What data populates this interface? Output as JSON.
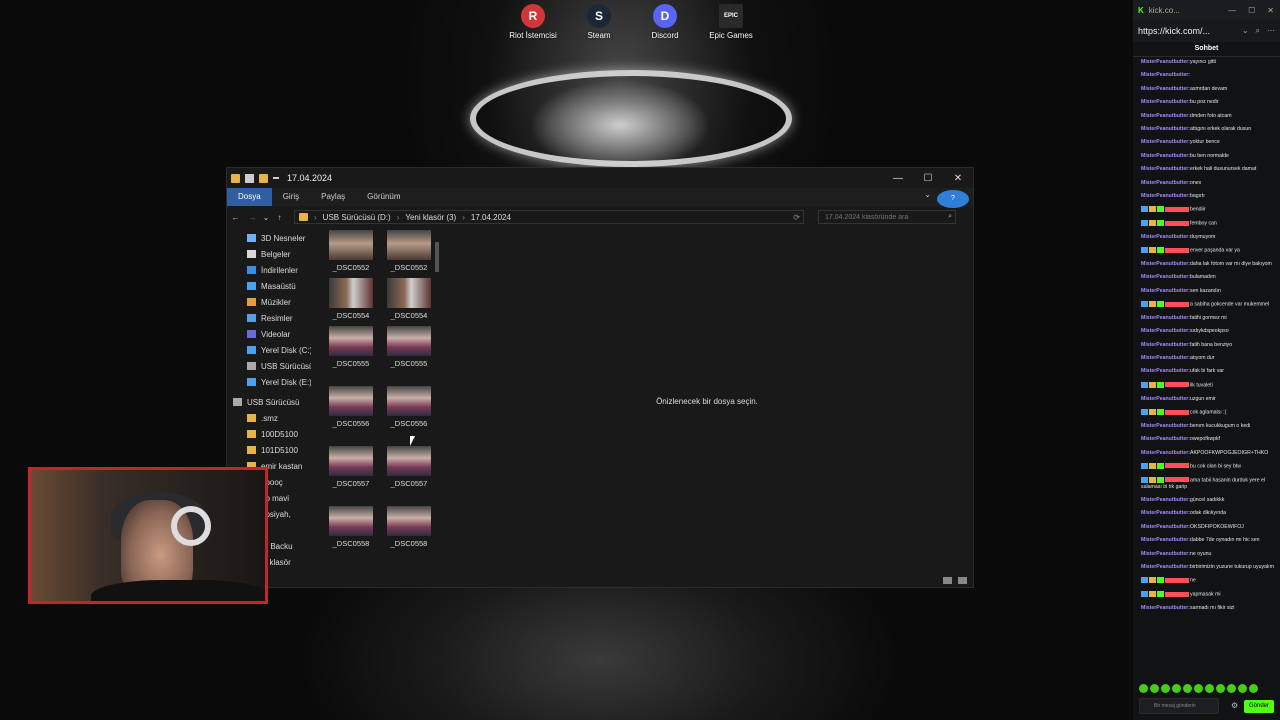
{
  "desktop": {
    "icons": [
      {
        "label": "Riot İstemcisi",
        "icon": "riot-client-icon",
        "color": "#d13639",
        "glyph": "R"
      },
      {
        "label": "Steam",
        "icon": "steam-icon",
        "color": "#1b2838",
        "glyph": "S"
      },
      {
        "label": "Discord",
        "icon": "discord-icon",
        "color": "#5865f2",
        "glyph": "D"
      },
      {
        "label": "Epic Games",
        "icon": "epic-games-icon",
        "color": "#2a2a2a",
        "glyph": "EPIC"
      }
    ]
  },
  "explorer": {
    "title": "17.04.2024",
    "ribbon_tabs": [
      "Dosya",
      "Giriş",
      "Paylaş",
      "Görünüm"
    ],
    "breadcrumb": [
      "USB Sürücüsü (D:)",
      "Yeni klasör (3)",
      "17.04.2024"
    ],
    "search_placeholder": "17.04.2024 klasöründe ara",
    "nav_items": [
      "3D Nesneler",
      "Belgeler",
      "İndirilenler",
      "Masaüstü",
      "Müzikler",
      "Resimler",
      "Videolar",
      "Yerel Disk (C:)",
      "USB Sürücüsü",
      "Yerel Disk (E:)",
      "USB Sürücüsü",
      ".smz",
      "100D5100",
      "101D5100",
      "emir kastan",
      "ooooç",
      "up mavi",
      "upsiyah,",
      "o",
      "IZ Backu",
      "ni klasör"
    ],
    "files": [
      [
        "_DSC0552",
        "_DSC0552"
      ],
      [
        "_DSC0554",
        "_DSC0554"
      ],
      [
        "_DSC0555",
        "_DSC0555"
      ],
      [
        "_DSC0556",
        "_DSC0556"
      ],
      [
        "_DSC0557",
        "_DSC0557"
      ],
      [
        "_DSC0558",
        "_DSC0558"
      ]
    ],
    "preview_text": "Önizlenecek bir dosya seçin."
  },
  "chat": {
    "tab_title": "kick.co...",
    "url": "https://kick.com/...",
    "header": "Sohbet",
    "input_placeholder": "Bir mesaj gönderin",
    "send_label": "Gönder",
    "messages": [
      {
        "user": "MisterPeanutbutter:",
        "text": "yayıncı gitti",
        "color": "#a58cff"
      },
      {
        "user": "MisterPeanutbutter:",
        "text": "",
        "color": "#a58cff"
      },
      {
        "user": "MisterPeanutbutter:",
        "text": "asmrdan devam",
        "color": "#a58cff"
      },
      {
        "user": "MisterPeanutbutter:",
        "text": "bu poz nedir",
        "color": "#a58cff"
      },
      {
        "user": "MisterPeanutbutter:",
        "text": "dmden foto atcam",
        "color": "#a58cff"
      },
      {
        "user": "MisterPeanutbutter:",
        "text": "attıgını erkek olarak dusun",
        "color": "#a58cff"
      },
      {
        "user": "MisterPeanutbutter:",
        "text": "yoktur bence",
        "color": "#a58cff"
      },
      {
        "user": "MisterPeanutbutter:",
        "text": "bu ben normalde",
        "color": "#a58cff"
      },
      {
        "user": "MisterPeanutbutter:",
        "text": "erkek hali dusunursek damat",
        "color": "#a58cff"
      },
      {
        "user": "MisterPeanutbutter:",
        "text": "onex",
        "color": "#a58cff"
      },
      {
        "user": "MisterPeanutbutter:",
        "text": "bagırtı",
        "color": "#a58cff"
      },
      {
        "user": "",
        "text": "bendiir",
        "color": "#ff4d5a",
        "badges": true
      },
      {
        "user": "",
        "text": "femboy can",
        "color": "#ff4d5a",
        "badges": true
      },
      {
        "user": "MisterPeanutbutter:",
        "text": "duymuyom",
        "color": "#a58cff"
      },
      {
        "user": "",
        "text": "enver paşanda var ya",
        "color": "#ff4d5a",
        "badges": true
      },
      {
        "user": "MisterPeanutbutter:",
        "text": "daha lak fotom var mı diye bakıyom",
        "color": "#a58cff"
      },
      {
        "user": "MisterPeanutbutter:",
        "text": "bulamadım",
        "color": "#a58cff"
      },
      {
        "user": "MisterPeanutbutter:",
        "text": "sen kazandın",
        "color": "#a58cff"
      },
      {
        "user": "",
        "text": "a sabiha gokcende var mukemmel",
        "color": "#ff4d5a",
        "badges": true
      },
      {
        "user": "MisterPeanutbutter:",
        "text": "fatihi gormez mi",
        "color": "#a58cff"
      },
      {
        "user": "MisterPeanutbutter:",
        "text": "sıdıykdspeokpso",
        "color": "#a58cff"
      },
      {
        "user": "MisterPeanutbutter:",
        "text": "fatih bana benziyo",
        "color": "#a58cff"
      },
      {
        "user": "MisterPeanutbutter:",
        "text": "atıyom dur",
        "color": "#a58cff"
      },
      {
        "user": "MisterPeanutbutter:",
        "text": "ufak bi fark var",
        "color": "#a58cff"
      },
      {
        "user": "",
        "text": "ilk tuvaleti",
        "color": "#ff4d5a",
        "badges": true
      },
      {
        "user": "MisterPeanutbutter:",
        "text": "uzgun emir",
        "color": "#a58cff"
      },
      {
        "user": "",
        "text": "cok aglamalsı :(",
        "color": "#ff4d5a",
        "badges": true
      },
      {
        "user": "MisterPeanutbutter:",
        "text": "benım kucukkugum o kedi",
        "color": "#a58cff"
      },
      {
        "user": "MisterPeanutbutter:",
        "text": "owepofkwpkf",
        "color": "#a58cff"
      },
      {
        "user": "MisterPeanutbutter:",
        "text": "AKPOOFKWPOGJEOIGR+THKO",
        "color": "#a58cff"
      },
      {
        "user": "",
        "text": "bu cok olan bi sey btw",
        "color": "#ff4d5a",
        "badges": true
      },
      {
        "user": "",
        "text": "ama tabii hasanin durduk yere el salaması bi tık garip",
        "color": "#ff4d5a",
        "badges": true
      },
      {
        "user": "MisterPeanutbutter:",
        "text": "güncel sadıkkk",
        "color": "#a58cff"
      },
      {
        "user": "MisterPeanutbutter:",
        "text": "odak dikılıyında",
        "color": "#a58cff"
      },
      {
        "user": "MisterPeanutbutter:",
        "text": "OKSDFIPOKOEWIFOJ",
        "color": "#a58cff"
      },
      {
        "user": "MisterPeanutbutter:",
        "text": "dabbe 7de oynadın mı hic sen",
        "color": "#a58cff"
      },
      {
        "user": "MisterPeanutbutter:",
        "text": "ne oyunu",
        "color": "#a58cff"
      },
      {
        "user": "MisterPeanutbutter:",
        "text": "birbirimizin yuzune tukurup uyuyalım",
        "color": "#a58cff"
      },
      {
        "user": "",
        "text": "ne",
        "color": "#ff4d5a",
        "badges": true
      },
      {
        "user": "",
        "text": "yapmasak mi",
        "color": "#ff4d5a",
        "badges": true
      },
      {
        "user": "MisterPeanutbutter:",
        "text": "sarmadı mı fikir sizi",
        "color": "#a58cff"
      }
    ]
  }
}
